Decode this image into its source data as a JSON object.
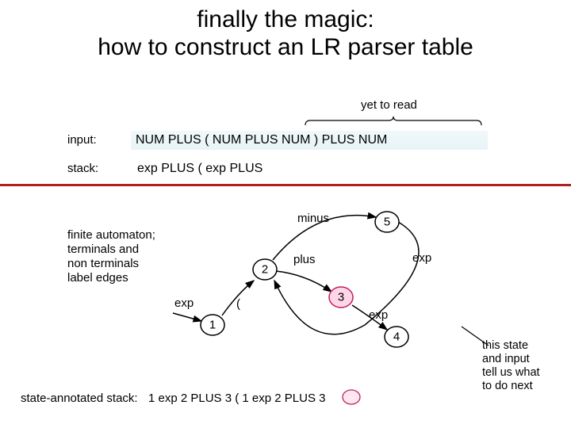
{
  "title_line1": "finally the magic:",
  "title_line2": "how to construct an LR parser table",
  "yet_to_read": "yet to read",
  "labels": {
    "input": "input:",
    "stack": "stack:",
    "state_annotated_stack": "state-annotated stack:"
  },
  "input_text": "NUM PLUS ( NUM  PLUS NUM ) PLUS NUM",
  "stack_text": "exp PLUS ( exp PLUS",
  "description": "finite automaton;\nterminals and\nnon terminals\nlabel edges",
  "diagram": {
    "nodes": {
      "n1": "1",
      "n2": "2",
      "n3": "3",
      "n4": "4",
      "n5": "5"
    },
    "edges": {
      "exp12": "exp",
      "lparen": "(",
      "plus23": "plus",
      "minus25": "minus",
      "exp5": "exp",
      "exp34": "exp"
    }
  },
  "note": "this state\nand input\ntell us what\nto do next",
  "state_annotated_stack": "1 exp 2 PLUS 3 ( 1 exp 2 PLUS 3"
}
